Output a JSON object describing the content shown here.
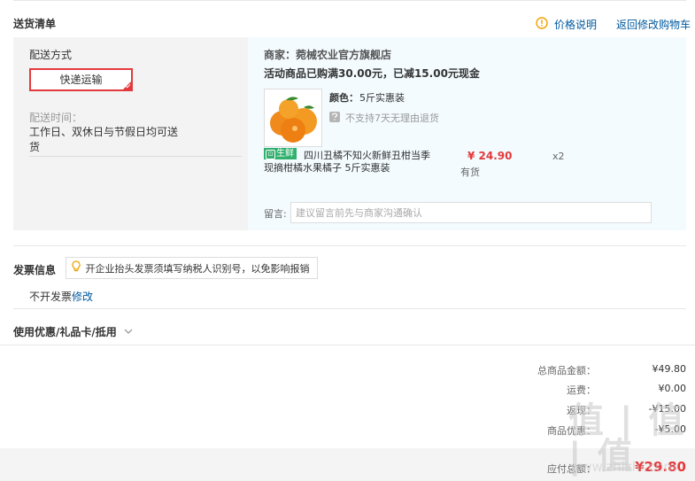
{
  "delivery": {
    "title": "送货清单",
    "price_info_label": "价格说明",
    "back_to_cart_label": "返回修改购物车",
    "method_title": "配送方式",
    "method_selected": "快递运输",
    "time_label": "配送时间：",
    "time_line1": "工作日、双休日与节假日均可送",
    "time_line2": "货"
  },
  "shop": {
    "merchant": "商家：菀械农业官方旗舰店",
    "promo": "活动商品已购满30.00元，已减15.00元现金",
    "product": {
      "color_label": "颜色：",
      "color_value": "5斤实惠装",
      "return_policy": "不支持7天无理由退货",
      "fresh_tag": "生鲜",
      "name_line1": "四川丑橘不知火新鲜丑柑当季",
      "name_line2": "现摘柑橘水果橘子 5斤实惠装",
      "price": "¥ 24.90",
      "stock": "有货",
      "quantity": "x2"
    },
    "remark_label": "留言:",
    "remark_placeholder": "建议留言前先与商家沟通确认"
  },
  "invoice": {
    "title": "发票信息",
    "tip": "开企业抬头发票须填写纳税人识别号，以免影响报销",
    "status": "不开发票",
    "edit_label": "修改"
  },
  "coupon": {
    "title": "使用优惠/礼品卡/抵用"
  },
  "summary": {
    "total_label": "总商品金额：",
    "total_value": "¥49.80",
    "freight_label": "运费：",
    "freight_value": "¥0.00",
    "rebate_label": "返现：",
    "rebate_value": "-¥15.00",
    "discount_label": "商品优惠：",
    "discount_value": "-¥5.00",
    "payable_label": "应付总额：",
    "payable_value": "¥29.80"
  },
  "watermark": {
    "text": "值 | 值 | 值",
    "site": "www.zhizhi.com"
  },
  "colors": {
    "accent": "#e4393c",
    "link": "#005aa0",
    "fresh": "#31b06e",
    "shop_bg": "#f3fbfe"
  }
}
